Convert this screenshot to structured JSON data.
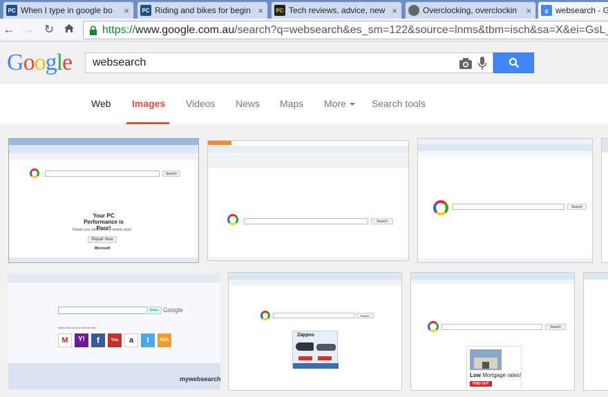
{
  "browser": {
    "tabs": [
      {
        "title": "When I type in google bo",
        "icon": "pcau-icon",
        "color": "#1d4f91"
      },
      {
        "title": "Riding and bikes for begin",
        "icon": "pcau-icon",
        "color": "#1d4f91"
      },
      {
        "title": "Tech reviews, advice, new",
        "icon": "pc-icon",
        "color": "#222222"
      },
      {
        "title": "Overclocking, overclockin",
        "icon": "globe-icon",
        "color": "#444444"
      },
      {
        "title": "websearch - Go",
        "icon": "google-icon",
        "color": "#4285f4"
      }
    ],
    "url_secure": "https://",
    "url_host": "www.google.com.au",
    "url_rest": "/search?q=websearch&es_sm=122&source=lnms&tbm=isch&sa=X&ei=GsL_"
  },
  "google": {
    "logo": "Google",
    "query": "websearch",
    "nav": {
      "web": "Web",
      "images": "Images",
      "videos": "Videos",
      "news": "News",
      "maps": "Maps",
      "more": "More",
      "search_tools": "Search tools"
    }
  },
  "thumbs": {
    "t1": {
      "headline": "Your PC Performance is Poor!",
      "sub": "Repair your windows in 3 simple steps",
      "button": "Repair Now",
      "brand": "Microsoft"
    },
    "t2": {
      "search": "Search"
    },
    "t3": {
      "search": "Search"
    },
    "t4": {
      "search": "Search",
      "caption": "Quick links to your favorite sites",
      "brand": "mywebsearch",
      "links": [
        "Gmail",
        "Yahoo",
        "Facebook",
        "YouTube",
        "Amazon",
        "Twitter",
        "AOL"
      ]
    },
    "t5": {
      "search": "Search",
      "ad": "Zappos"
    },
    "t6": {
      "search": "Search",
      "ad_low": "Low",
      "ad_text": "Mortgage rates!",
      "ad_btn": "FIND OUT"
    }
  },
  "colors": {
    "accent": "#dd4b39",
    "search_button": "#4285f4"
  }
}
